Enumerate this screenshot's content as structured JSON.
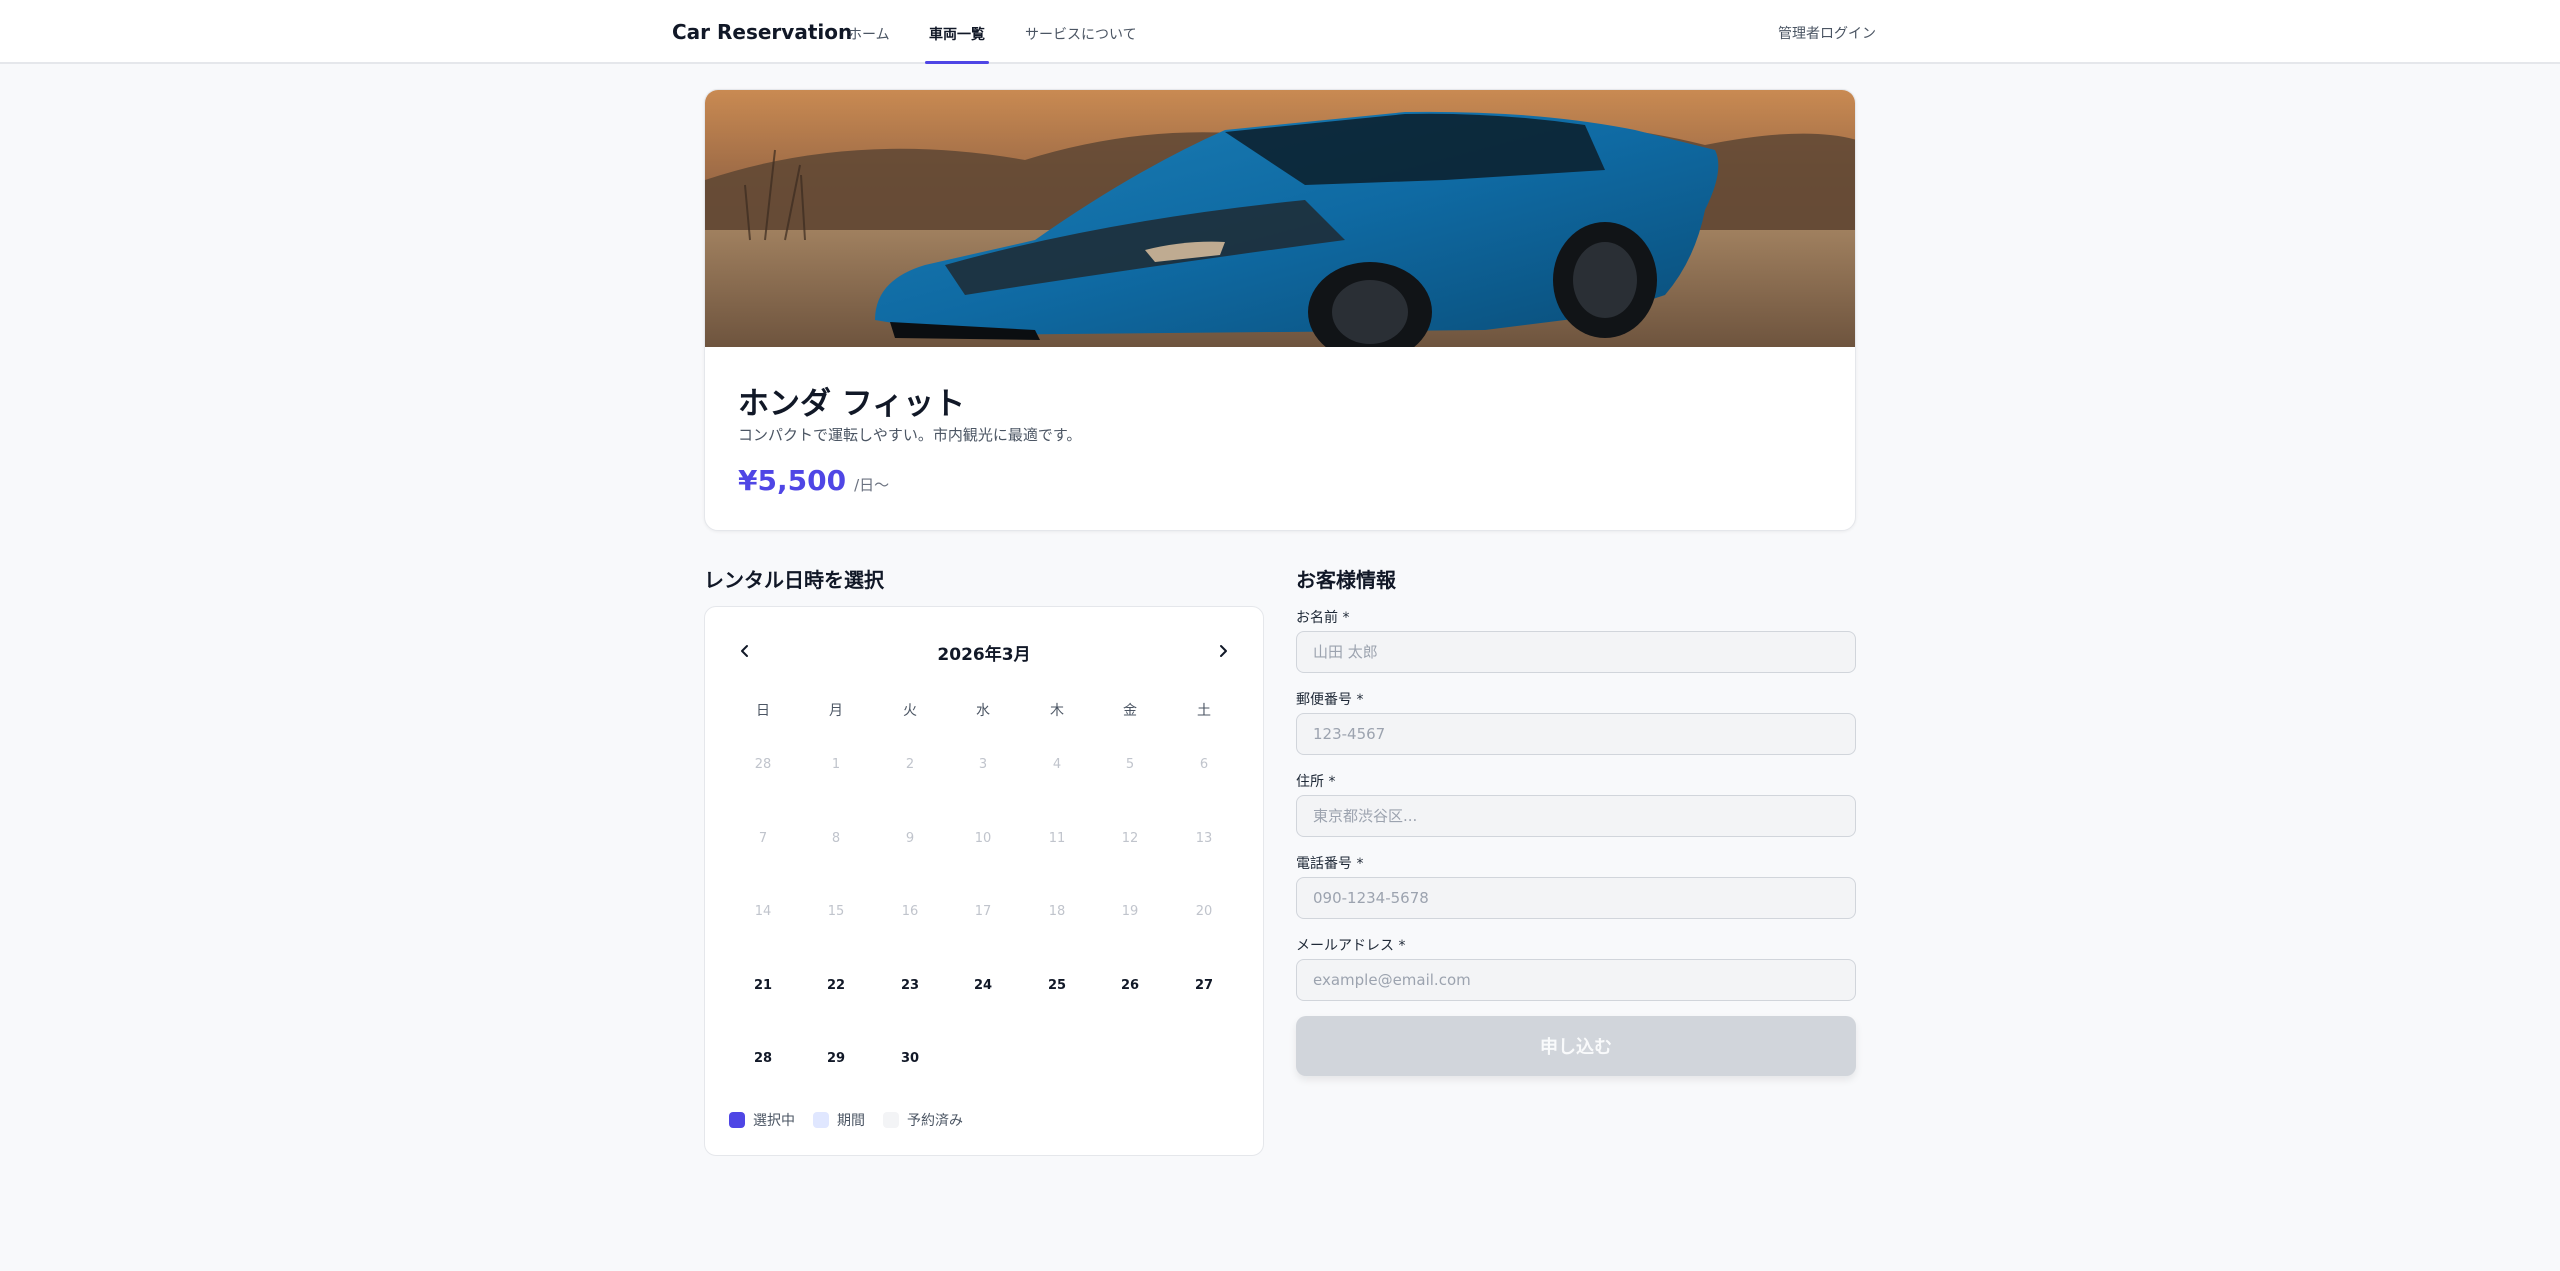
{
  "header": {
    "brand": "Car Reservation",
    "nav": [
      {
        "label": "ホーム",
        "active": false
      },
      {
        "label": "車両一覧",
        "active": true
      },
      {
        "label": "サービスについて",
        "active": false
      }
    ],
    "admin_login": "管理者ログイン"
  },
  "car": {
    "name": "ホンダ フィット",
    "description": "コンパクトで運転しやすい。市内観光に最適です。",
    "price": "¥5,500",
    "price_unit": "/日〜"
  },
  "calendar": {
    "section_title": "レンタル日時を選択",
    "month_label": "2026年3月",
    "weekdays": [
      "日",
      "月",
      "火",
      "水",
      "木",
      "金",
      "土"
    ],
    "weeks": [
      [
        "28",
        "1",
        "2",
        "3",
        "4",
        "5",
        "6"
      ],
      [
        "7",
        "8",
        "9",
        "10",
        "11",
        "12",
        "13"
      ],
      [
        "14",
        "15",
        "16",
        "17",
        "18",
        "19",
        "20"
      ],
      [
        "21",
        "22",
        "23",
        "24",
        "25",
        "26",
        "27"
      ],
      [
        "28",
        "29",
        "30",
        "",
        "",
        "",
        ""
      ]
    ],
    "disabled_weeks": [
      true,
      true,
      true,
      false,
      false
    ],
    "legend": {
      "selected": "選択中",
      "range": "期間",
      "booked": "予約済み"
    },
    "colors": {
      "selected": "#4f46e5",
      "range": "#e0e7ff",
      "booked": "#f3f4f6"
    }
  },
  "form": {
    "section_title": "お客様情報",
    "fields": [
      {
        "label": "お名前 *",
        "placeholder": "山田 太郎"
      },
      {
        "label": "郵便番号 *",
        "placeholder": "123-4567"
      },
      {
        "label": "住所 *",
        "placeholder": "東京都渋谷区..."
      },
      {
        "label": "電話番号 *",
        "placeholder": "090-1234-5678"
      },
      {
        "label": "メールアドレス *",
        "placeholder": "example@email.com"
      }
    ],
    "submit_label": "申し込む"
  },
  "theme": {
    "accent": "#4f46e5",
    "page_bg": "#f8f9fb",
    "disabled_button": "#d1d5db"
  }
}
